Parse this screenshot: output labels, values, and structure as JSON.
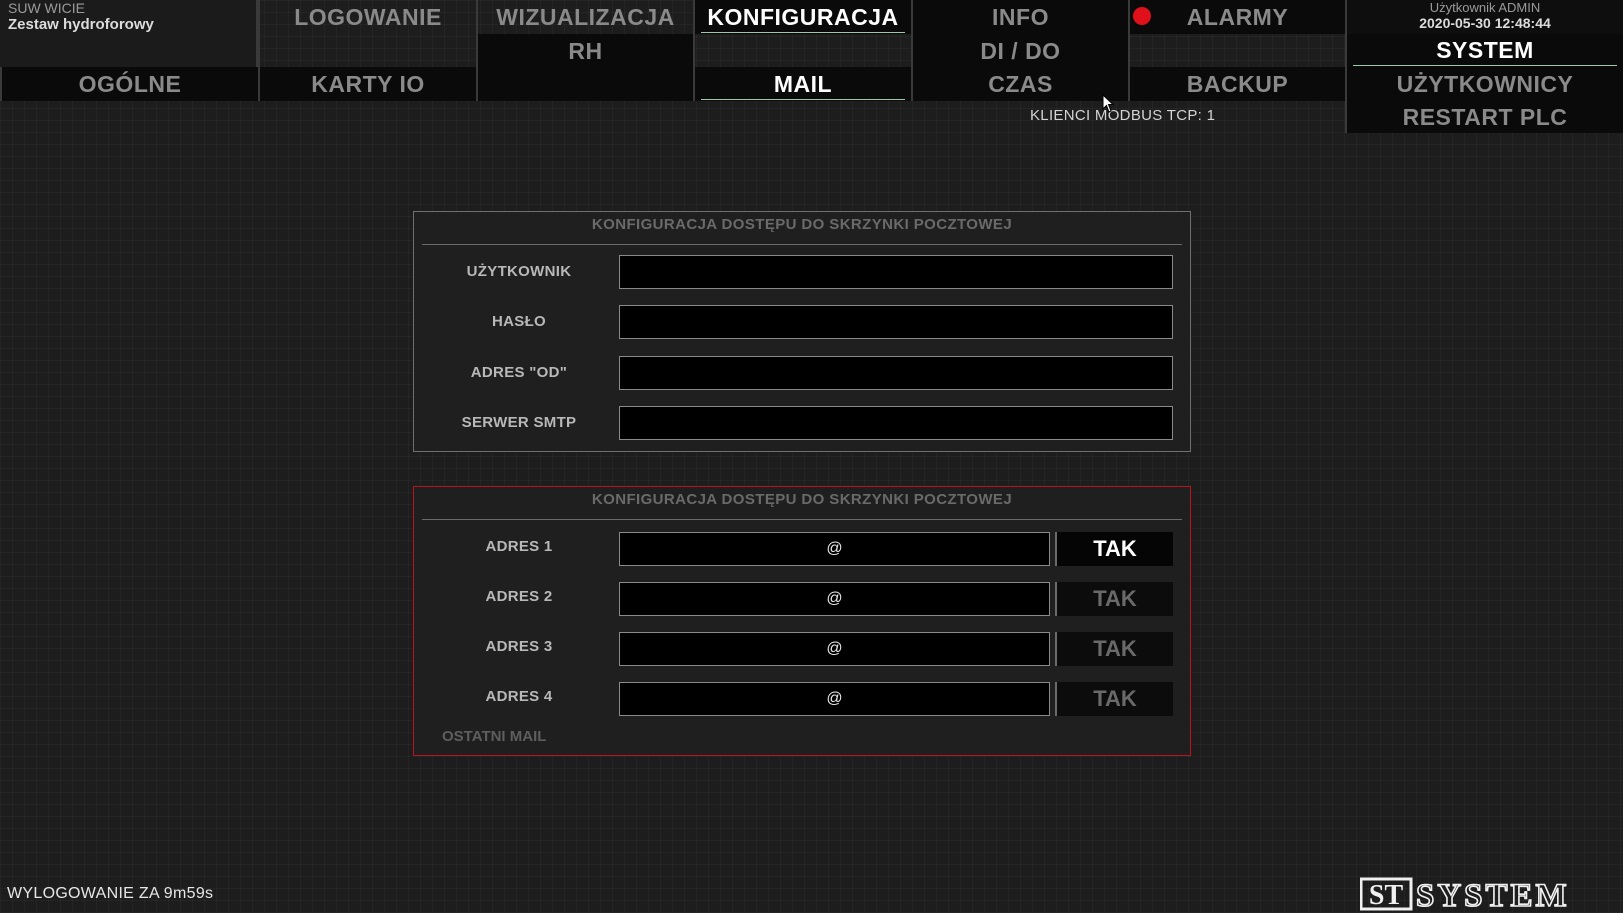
{
  "header": {
    "site": "SUW WICIE",
    "subtitle": "Zestaw hydroforowy",
    "user": "Użytkownik ADMIN",
    "datetime": "2020-05-30 12:48:44",
    "modbus_clients": "KLIENCI MODBUS TCP: 1",
    "alarm_color": "#e0101a"
  },
  "nav": {
    "logowanie": "LOGOWANIE",
    "wizualizacja": "WIZUALIZACJA",
    "rh": "RH",
    "konfiguracja": "KONFIGURACJA",
    "info": "INFO",
    "dido": "DI / DO",
    "czas": "CZAS",
    "alarmy": "ALARMY",
    "system": "SYSTEM",
    "uzytkownicy": "UŻYTKOWNICY",
    "restart": "RESTART PLC",
    "ogolne": "OGÓLNE",
    "karty_io": "KARTY IO",
    "mail": "MAIL",
    "backup": "BACKUP"
  },
  "mailbox_panel": {
    "title": "KONFIGURACJA DOSTĘPU DO SKRZYNKI POCZTOWEJ",
    "fields": [
      {
        "label": "UŻYTKOWNIK",
        "value": ""
      },
      {
        "label": "HASŁO",
        "value": ""
      },
      {
        "label": "ADRES \"OD\"",
        "value": ""
      },
      {
        "label": "SERWER SMTP",
        "value": ""
      }
    ]
  },
  "recipients_panel": {
    "title": "KONFIGURACJA DOSTĘPU DO SKRZYNKI POCZTOWEJ",
    "rows": [
      {
        "label": "ADRES 1",
        "value": "@",
        "toggle": "TAK",
        "active": true
      },
      {
        "label": "ADRES 2",
        "value": "@",
        "toggle": "TAK",
        "active": false
      },
      {
        "label": "ADRES 3",
        "value": "@",
        "toggle": "TAK",
        "active": false
      },
      {
        "label": "ADRES 4",
        "value": "@",
        "toggle": "TAK",
        "active": false
      }
    ],
    "last_mail_label": "OSTATNI MAIL"
  },
  "footer": {
    "logout": "WYLOGOWANIE ZA 9m59s",
    "logo_prefix": "ST",
    "logo_text": "SYSTEM"
  }
}
